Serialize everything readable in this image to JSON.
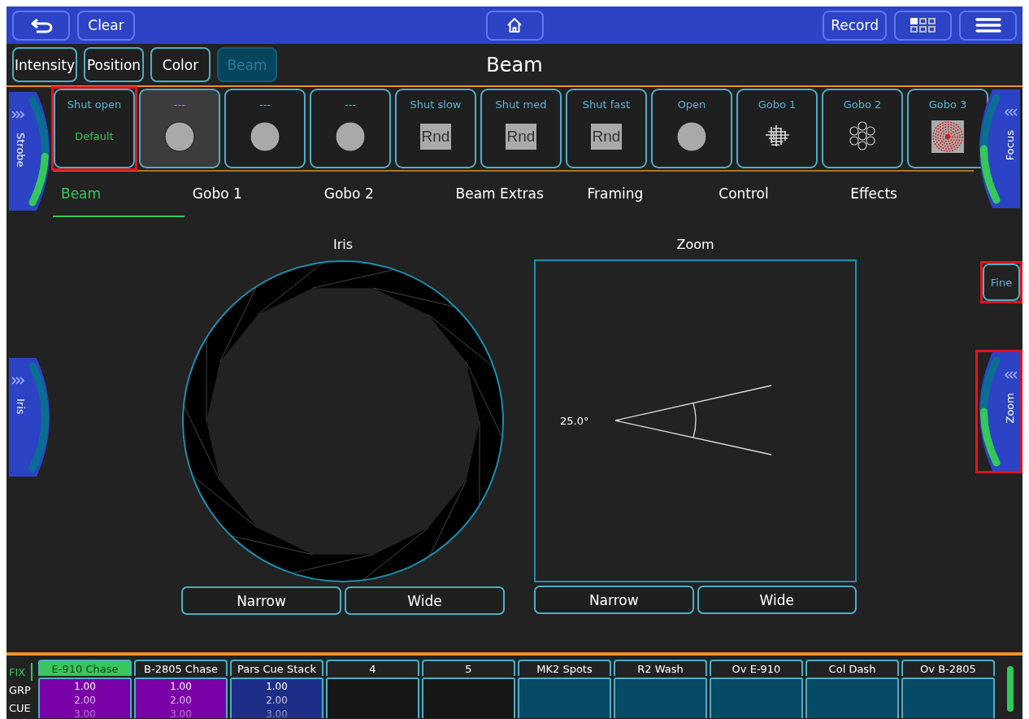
{
  "toolbar": {
    "left": [
      {
        "kind": "back"
      },
      {
        "kind": "text",
        "label": "Clear"
      }
    ],
    "center": [
      {
        "kind": "home"
      }
    ],
    "right": [
      {
        "kind": "text",
        "label": "Record"
      },
      {
        "kind": "grid"
      },
      {
        "kind": "menu"
      }
    ]
  },
  "attribute_tabs": [
    {
      "label": "Intensity",
      "selected": false
    },
    {
      "label": "Position",
      "selected": false
    },
    {
      "label": "Color",
      "selected": false
    },
    {
      "label": "Beam",
      "selected": true
    }
  ],
  "title": "Beam",
  "palettes": [
    {
      "label": "Shut open",
      "kind": "text",
      "value": "Default",
      "selected": false,
      "highlighted": true
    },
    {
      "label": "---",
      "kind": "circle",
      "selected": true,
      "highlighted": false
    },
    {
      "label": "---",
      "kind": "circle",
      "selected": false,
      "highlighted": false
    },
    {
      "label": "---",
      "kind": "circle",
      "selected": false,
      "highlighted": false
    },
    {
      "label": "Shut slow",
      "kind": "rnd",
      "value": "Rnd",
      "selected": false,
      "highlighted": false
    },
    {
      "label": "Shut med",
      "kind": "rnd",
      "value": "Rnd",
      "selected": false,
      "highlighted": false
    },
    {
      "label": "Shut fast",
      "kind": "rnd",
      "value": "Rnd",
      "selected": false,
      "highlighted": false
    },
    {
      "label": "Open",
      "kind": "circle",
      "selected": false,
      "highlighted": false
    },
    {
      "label": "Gobo 1",
      "kind": "gobo-shards",
      "selected": false,
      "highlighted": false
    },
    {
      "label": "Gobo 2",
      "kind": "gobo-rings",
      "selected": false,
      "highlighted": false
    },
    {
      "label": "Gobo 3",
      "kind": "gobo-spiral",
      "selected": false,
      "highlighted": false
    }
  ],
  "left_wheels": [
    {
      "label": "Strobe",
      "level": 0.45,
      "highlighted": false
    },
    {
      "label": "Iris",
      "highlighted": false
    }
  ],
  "right_controls": [
    {
      "kind": "wheel",
      "label": "Focus",
      "level": 0.5,
      "highlighted": false
    },
    {
      "kind": "button",
      "label": "Fine",
      "highlighted": true
    },
    {
      "kind": "wheel",
      "label": "Zoom",
      "level": 0.5,
      "highlighted": true
    }
  ],
  "section_tabs": [
    {
      "label": "Beam",
      "selected": true
    },
    {
      "label": "Gobo 1",
      "selected": false
    },
    {
      "label": "Gobo 2",
      "selected": false
    },
    {
      "label": "Beam Extras",
      "selected": false
    },
    {
      "label": "Framing",
      "selected": false
    },
    {
      "label": "Control",
      "selected": false
    },
    {
      "label": "Effects",
      "selected": false
    }
  ],
  "iris": {
    "title": "Iris",
    "buttons": [
      "Narrow",
      "Wide"
    ]
  },
  "zoom": {
    "title": "Zoom",
    "angle": "25.0°",
    "buttons": [
      "Narrow",
      "Wide"
    ]
  },
  "modes": [
    {
      "label": "FIX",
      "selected": true
    },
    {
      "label": "GRP",
      "selected": false
    },
    {
      "label": "CUE",
      "selected": false
    }
  ],
  "playbacks": [
    {
      "name": "E-910 Chase",
      "selected": true,
      "color": "#7a00a8",
      "values": [
        "1.00",
        "2.00",
        "3.00"
      ]
    },
    {
      "name": "B-2805 Chase",
      "selected": false,
      "color": "#7a00a8",
      "values": [
        "1.00",
        "2.00",
        "3.00"
      ]
    },
    {
      "name": "Pars Cue Stack",
      "selected": false,
      "color": "#1e2e88",
      "values": [
        "1.00",
        "2.00",
        "3.00"
      ]
    },
    {
      "name": "4",
      "selected": false,
      "color": "#161616"
    },
    {
      "name": "5",
      "selected": false,
      "color": "#161616"
    },
    {
      "name": "MK2 Spots",
      "selected": false,
      "color": "#064a66"
    },
    {
      "name": "R2 Wash",
      "selected": false,
      "color": "#064a66"
    },
    {
      "name": "Ov E-910",
      "selected": false,
      "color": "#064a66"
    },
    {
      "name": "Col Dash",
      "selected": false,
      "color": "#064a66"
    },
    {
      "name": "Ov B-2805",
      "selected": false,
      "color": "#064a66"
    }
  ]
}
